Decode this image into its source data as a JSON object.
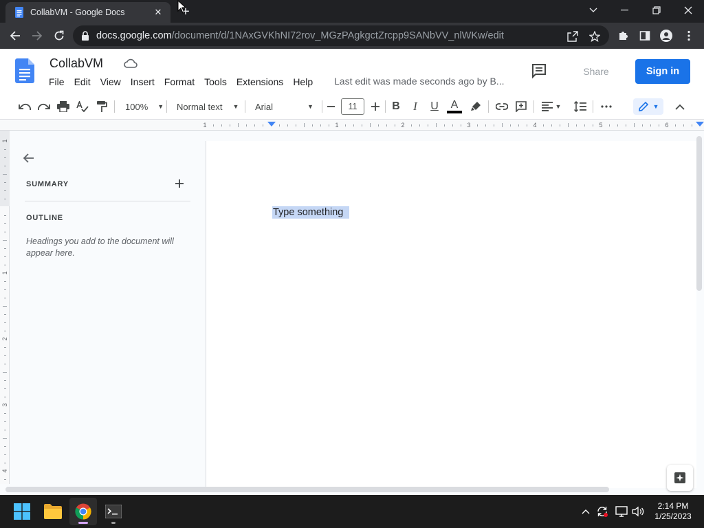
{
  "browser": {
    "tab_title": "CollabVM - Google Docs",
    "url_domain": "docs.google.com",
    "url_path": "/document/d/1NAxGVKhNI72rov_MGzPAgkgctZrcpp9SANbVV_nlWKw/edit"
  },
  "docs": {
    "title": "CollabVM",
    "menu": [
      "File",
      "Edit",
      "View",
      "Insert",
      "Format",
      "Tools",
      "Extensions",
      "Help"
    ],
    "last_edit": "Last edit was made seconds ago by B...",
    "share_label": "Share",
    "signin_label": "Sign in"
  },
  "toolbar": {
    "zoom": "100%",
    "style": "Normal text",
    "font": "Arial",
    "font_size": "11"
  },
  "ruler": {
    "labels": [
      "1",
      "1",
      "2",
      "3",
      "4",
      "5",
      "6"
    ],
    "vlabels": [
      "1",
      "1",
      "2",
      "3",
      "4"
    ]
  },
  "outline": {
    "summary_label": "SUMMARY",
    "outline_label": "OUTLINE",
    "hint": "Headings you add to the document will appear here."
  },
  "document": {
    "text": "Type something"
  },
  "taskbar": {
    "time": "2:14 PM",
    "date": "1/25/2023"
  },
  "colors": {
    "accent": "#1a73e8",
    "selection": "#c5d7f5",
    "chrome_dark": "#202124"
  }
}
